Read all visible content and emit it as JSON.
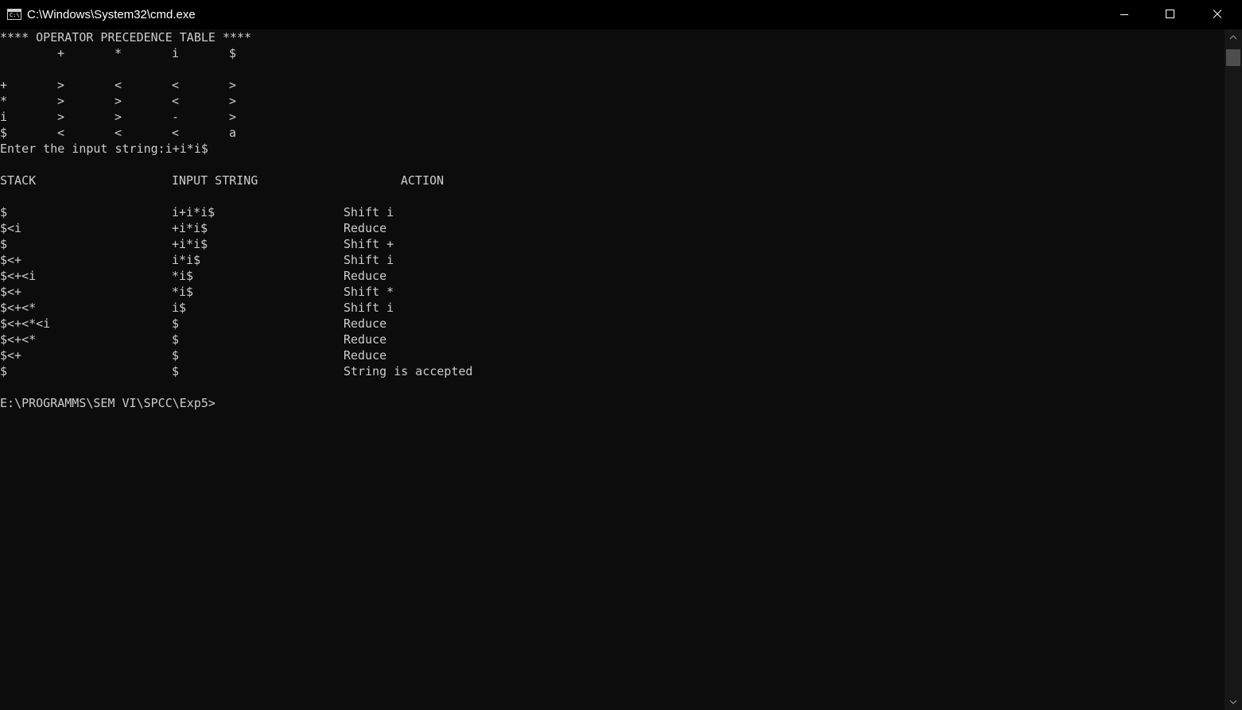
{
  "window": {
    "title": "C:\\Windows\\System32\\cmd.exe",
    "icon_text": "C:\\"
  },
  "console": {
    "table_header": "**** OPERATOR PRECEDENCE TABLE ****",
    "column_headers": [
      "+",
      "*",
      "i",
      "$"
    ],
    "precedence_rows": [
      {
        "symbol": "+",
        "cells": [
          ">",
          "<",
          "<",
          ">"
        ]
      },
      {
        "symbol": "*",
        "cells": [
          ">",
          ">",
          "<",
          ">"
        ]
      },
      {
        "symbol": "i",
        "cells": [
          ">",
          ">",
          "-",
          ">"
        ]
      },
      {
        "symbol": "$",
        "cells": [
          "<",
          "<",
          "<",
          "a"
        ]
      }
    ],
    "input_prompt": "Enter the input string:i+i*i$",
    "parse_headers": {
      "stack": "STACK",
      "input": "INPUT STRING",
      "action": "ACTION"
    },
    "parse_rows": [
      {
        "stack": "$",
        "input": "i+i*i$",
        "action": "Shift i"
      },
      {
        "stack": "$<i",
        "input": "+i*i$",
        "action": "Reduce"
      },
      {
        "stack": "$",
        "input": "+i*i$",
        "action": "Shift +"
      },
      {
        "stack": "$<+",
        "input": "i*i$",
        "action": "Shift i"
      },
      {
        "stack": "$<+<i",
        "input": "*i$",
        "action": "Reduce"
      },
      {
        "stack": "$<+",
        "input": "*i$",
        "action": "Shift *"
      },
      {
        "stack": "$<+<*",
        "input": "i$",
        "action": "Shift i"
      },
      {
        "stack": "$<+<*<i",
        "input": "$",
        "action": "Reduce"
      },
      {
        "stack": "$<+<*",
        "input": "$",
        "action": "Reduce"
      },
      {
        "stack": "$<+",
        "input": "$",
        "action": "Reduce"
      },
      {
        "stack": "$",
        "input": "$",
        "action": "String is accepted"
      }
    ],
    "shell_prompt": "E:\\PROGRAMMS\\SEM VI\\SPCC\\Exp5>"
  },
  "icons": {
    "minimize": "minimize-icon",
    "maximize": "maximize-icon",
    "close": "close-icon",
    "scroll_up": "arrow-up-icon",
    "scroll_down": "arrow-down-icon"
  },
  "colors": {
    "background": "#0c0c0c",
    "titlebar": "#000000",
    "text": "#cccccc"
  }
}
